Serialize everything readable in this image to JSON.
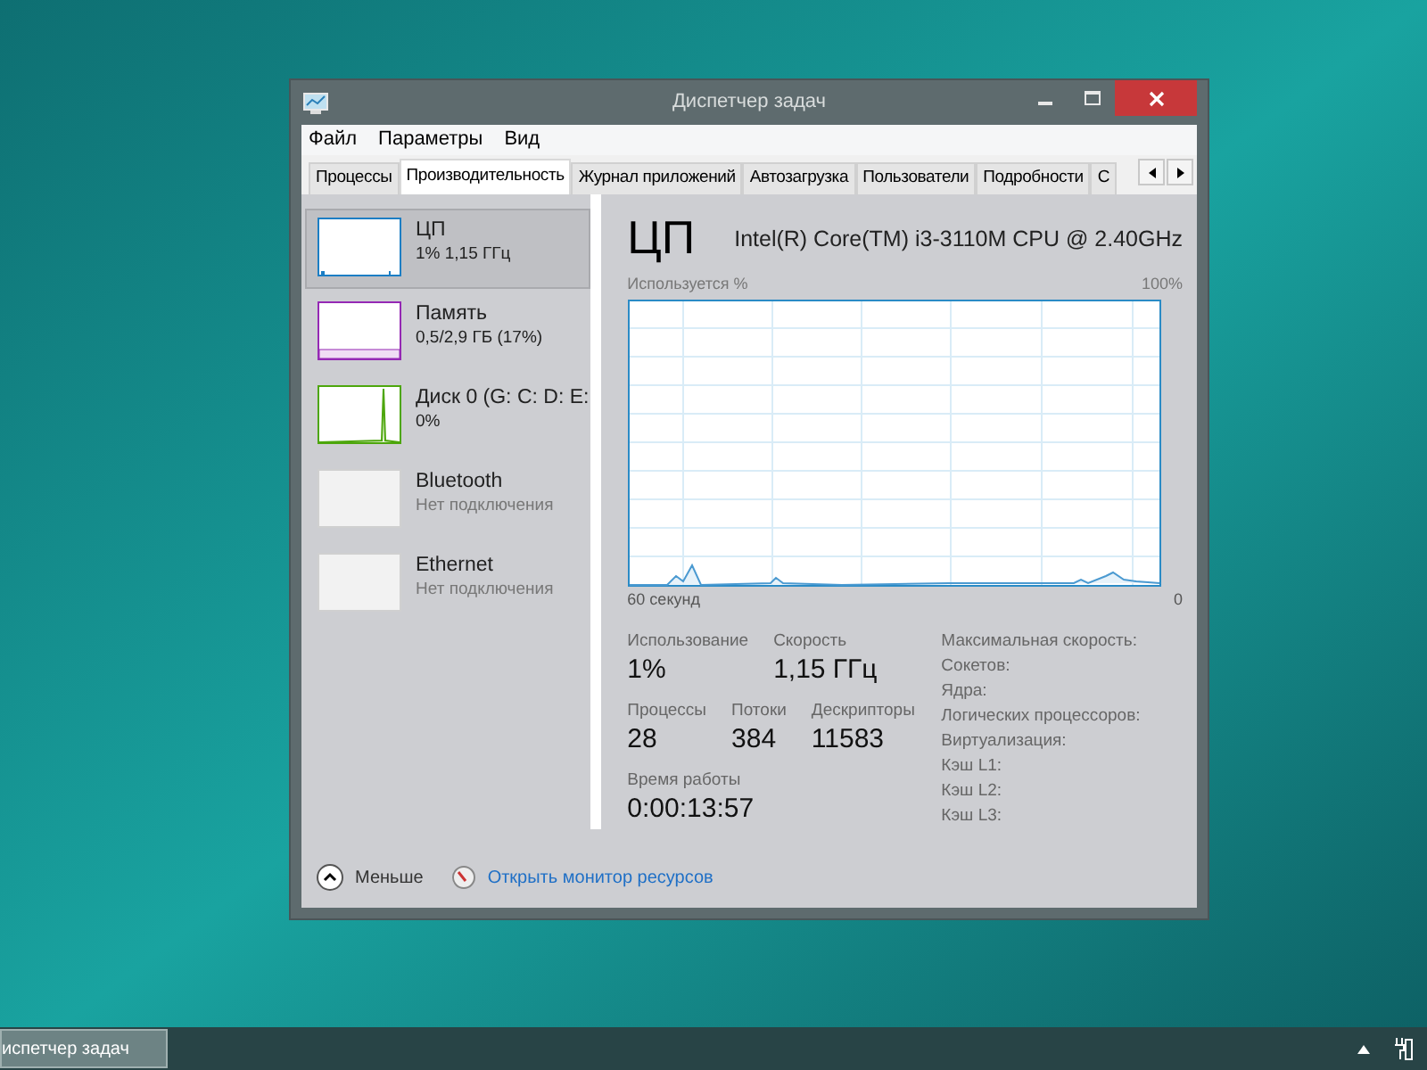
{
  "window": {
    "title": "Диспетчер задач"
  },
  "menu": [
    "Файл",
    "Параметры",
    "Вид"
  ],
  "tabs": [
    {
      "label": "Процессы",
      "selected": false
    },
    {
      "label": "Производительность",
      "selected": true
    },
    {
      "label": "Журнал приложений",
      "selected": false
    },
    {
      "label": "Автозагрузка",
      "selected": false
    },
    {
      "label": "Пользователи",
      "selected": false
    },
    {
      "label": "Подробности",
      "selected": false
    },
    {
      "label": "С",
      "selected": false
    }
  ],
  "sidebar": {
    "items": [
      {
        "kind": "cpu",
        "name": "ЦП",
        "detail": "1% 1,15 ГГц",
        "selected": true,
        "color": "#1c7ec4"
      },
      {
        "kind": "memory",
        "name": "Память",
        "detail": "0,5/2,9 ГБ (17%)",
        "selected": false,
        "color": "#9528b4"
      },
      {
        "kind": "disk",
        "name": "Диск 0 (G: C: D: E:",
        "detail": "0%",
        "selected": false,
        "color": "#4da60c"
      },
      {
        "kind": "empty",
        "name": "Bluetooth",
        "detail": "Нет подключения",
        "selected": false
      },
      {
        "kind": "empty",
        "name": "Ethernet",
        "detail": "Нет подключения",
        "selected": false
      }
    ]
  },
  "panel": {
    "title": "ЦП",
    "model": "Intel(R) Core(TM) i3-3110M CPU @ 2.40GHz",
    "graph_label": "Используется %",
    "graph_max": "100%",
    "graph_time": "60 секунд",
    "graph_min": "0",
    "stats": [
      [
        {
          "label": "Использование",
          "value": "1%"
        },
        {
          "label": "Скорость",
          "value": "1,15 ГГц"
        }
      ],
      [
        {
          "label": "Процессы",
          "value": "28"
        },
        {
          "label": "Потоки",
          "value": "384"
        },
        {
          "label": "Дескрипторы",
          "value": "11583"
        }
      ],
      [
        {
          "label": "Время работы",
          "value": "0:00:13:57"
        }
      ]
    ],
    "specs": [
      "Максимальная скорость:",
      "Сокетов:",
      "Ядра:",
      "Логических процессоров:",
      "Виртуализация:",
      "Кэш L1:",
      "Кэш L2:",
      "Кэш L3:"
    ]
  },
  "footer": {
    "less": "Меньше",
    "monitor": "Открыть монитор ресурсов"
  },
  "taskbar": {
    "button": "испетчер задач"
  }
}
